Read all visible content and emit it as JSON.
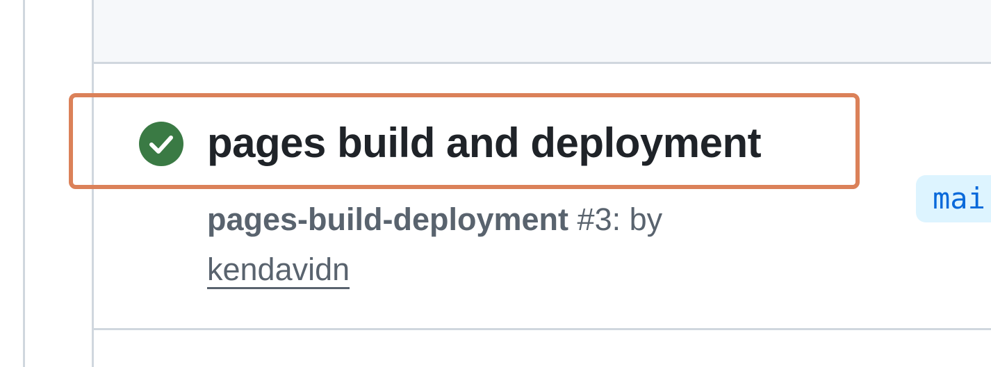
{
  "run": {
    "title": "pages build and deployment",
    "status": "success",
    "status_icon": "check-circle-fill-icon",
    "status_color": "#1a7f37",
    "workflow_name": "pages-build-deployment",
    "run_number": "#3",
    "by_text": ": by",
    "actor": "kendavidn",
    "branch": "mai"
  },
  "colors": {
    "highlight": "#db8159",
    "border": "#d0d7de",
    "header_bg": "#f6f8fa",
    "title_text": "#1f2328",
    "meta_text": "#59636e",
    "branch_bg": "#ddf4ff",
    "branch_text": "#0969da"
  }
}
